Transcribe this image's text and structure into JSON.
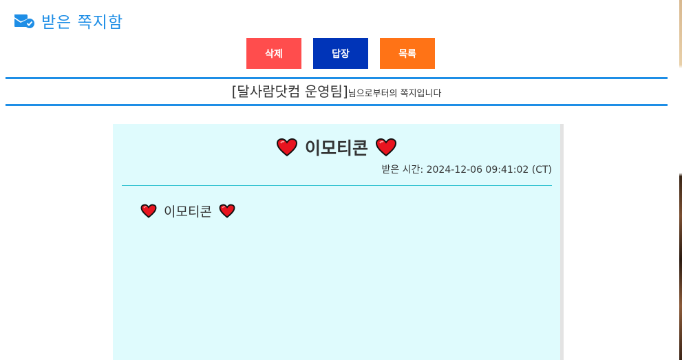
{
  "header": {
    "title": "받은 쪽지함",
    "icon": "mail-check-icon"
  },
  "buttons": {
    "delete_label": "삭제",
    "reply_label": "답장",
    "list_label": "목록",
    "delete_color": "#ff4d4d",
    "reply_color": "#0034b8",
    "list_color": "#ff7316"
  },
  "sender": {
    "name": "[달사람닷컴 운영팀]",
    "suffix": "님으로부터의 쪽지입니다"
  },
  "message": {
    "title": "이모티콘",
    "received_label": "받은 시간:",
    "received_time": "2024-12-06 09:41:02 (CT)",
    "body": "이모티콘",
    "emoji": "heart-icon"
  },
  "colors": {
    "accent": "#1e8ee6",
    "card_background": "#dffbfd",
    "divider": "#39c4d3"
  }
}
